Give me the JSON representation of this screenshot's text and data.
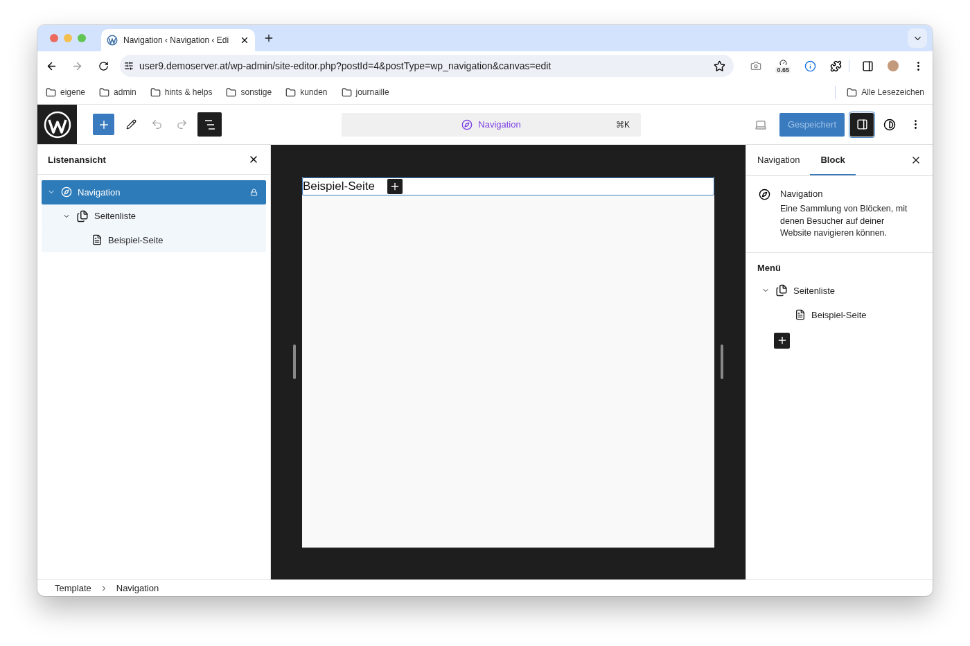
{
  "browser": {
    "tab": {
      "title": "Navigation ‹ Navigation ‹ Edi"
    },
    "address": "user9.demoserver.at/wp-admin/site-editor.php?postId=4&postType=wp_navigation&canvas=edit",
    "extension_badge": "0.65",
    "bookmarks": [
      "eigene",
      "admin",
      "hints & helps",
      "sonstige",
      "kunden",
      "journaille"
    ],
    "all_bookmarks": "Alle Lesezeichen"
  },
  "editor": {
    "command_bar": {
      "label": "Navigation",
      "shortcut": "⌘K"
    },
    "save_button": "Gespeichert",
    "list_view": {
      "title": "Listenansicht",
      "items": [
        {
          "label": "Navigation",
          "kind": "navigation",
          "selected": true,
          "expanded": true,
          "locked": true,
          "children": [
            {
              "label": "Seitenliste",
              "kind": "page-list",
              "selected": false,
              "expanded": true,
              "children": [
                {
                  "label": "Beispiel-Seite",
                  "kind": "page",
                  "selected": false
                }
              ]
            }
          ]
        }
      ]
    },
    "canvas": {
      "link": "Beispiel-Seite"
    },
    "sidebar": {
      "tabs": [
        {
          "label": "Navigation",
          "selected": false
        },
        {
          "label": "Block",
          "selected": true
        }
      ],
      "block": {
        "title": "Navigation",
        "description": "Eine Sammlung von Blöcken, mit denen Besucher auf deiner Website navigieren können."
      },
      "menu": {
        "title": "Menü",
        "items": [
          {
            "label": "Seitenliste",
            "kind": "page-list",
            "expanded": true,
            "children": [
              {
                "label": "Beispiel-Seite",
                "kind": "page"
              }
            ]
          }
        ]
      }
    },
    "breadcrumb": [
      "Template",
      "Navigation"
    ]
  }
}
